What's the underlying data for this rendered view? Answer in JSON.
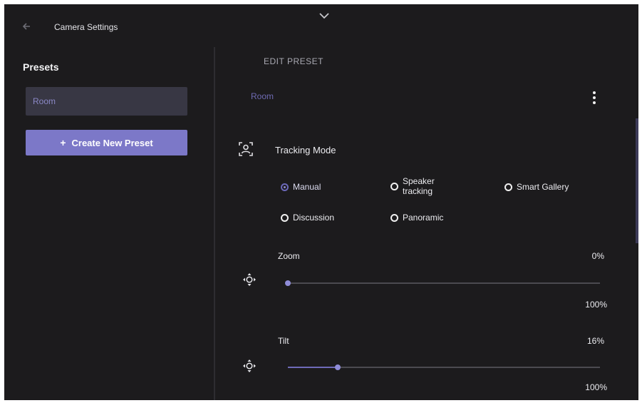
{
  "header": {
    "title": "Camera Settings",
    "back_icon": "arrow-left-icon",
    "collapse_icon": "chevron-down-icon"
  },
  "sidebar": {
    "heading": "Presets",
    "presets": [
      {
        "label": "Room",
        "selected": true
      }
    ],
    "create_button": {
      "icon": "+",
      "label": "Create New Preset"
    }
  },
  "editor": {
    "section_label": "EDIT PRESET",
    "preset_name": "Room",
    "more_icon": "more-vertical-icon",
    "tracking": {
      "label": "Tracking Mode",
      "icon": "person-tracking-icon",
      "options": [
        {
          "label": "Manual",
          "selected": true
        },
        {
          "label": "Speaker tracking",
          "line1": "Speaker",
          "line2": "tracking",
          "selected": false
        },
        {
          "label": "Smart Gallery",
          "selected": false
        },
        {
          "label": "Discussion",
          "selected": false
        },
        {
          "label": "Panoramic",
          "selected": false
        }
      ]
    },
    "zoom": {
      "label": "Zoom",
      "value_text": "0%",
      "max_text": "100%",
      "level": 0.0,
      "icon": "move-control-icon"
    },
    "tilt": {
      "label": "Tilt",
      "value_text": "16%",
      "max_text": "100%",
      "level": 0.16,
      "icon": "move-control-icon"
    }
  },
  "colors": {
    "background": "#1c1b1d",
    "accent": "#7c78c8",
    "preset_item_bg": "#383744",
    "text": "#e8e8ec"
  }
}
